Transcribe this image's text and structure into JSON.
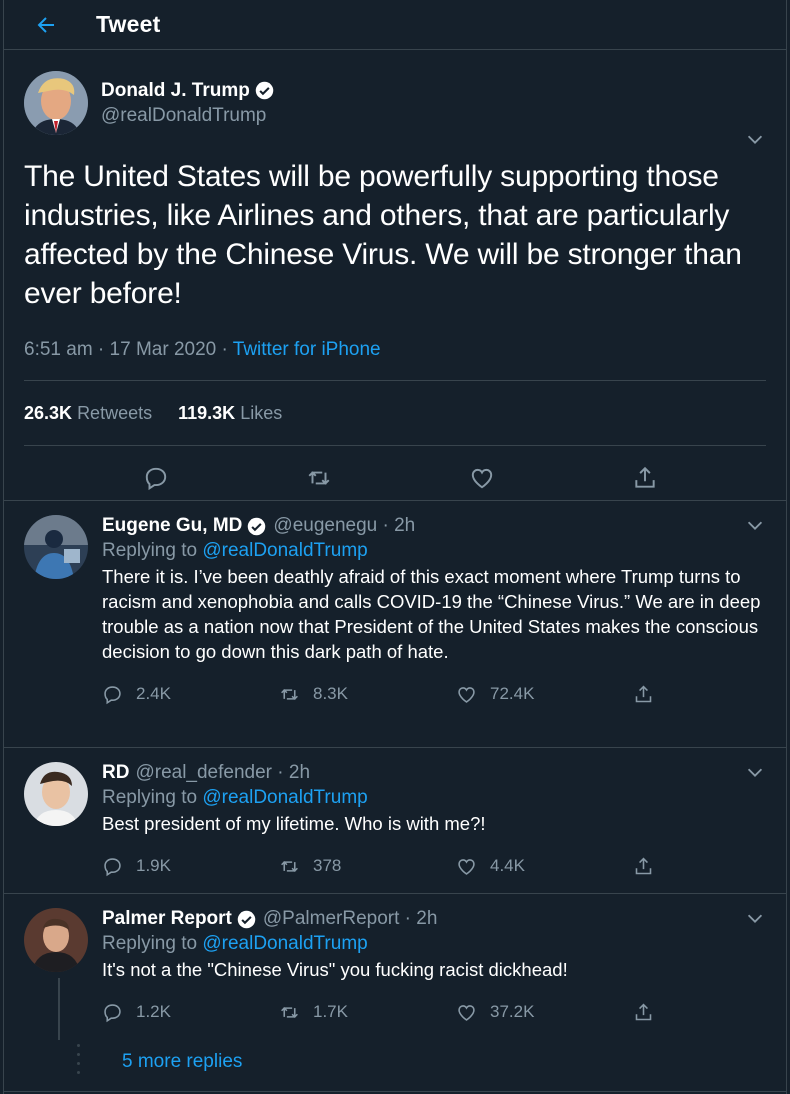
{
  "header": {
    "title": "Tweet"
  },
  "main_tweet": {
    "display_name": "Donald J. Trump",
    "handle": "@realDonaldTrump",
    "text": "The United States will be powerfully supporting those industries, like Airlines and others, that are particularly affected by the Chinese Virus. We will be stronger than ever before!",
    "time": "6:51 am · 17 Mar 2020 · ",
    "source": "Twitter for iPhone",
    "retweets_count": "26.3K",
    "retweets_label": "Retweets",
    "likes_count": "119.3K",
    "likes_label": "Likes"
  },
  "replies": [
    {
      "display_name": "Eugene Gu, MD",
      "handle": "@eugenegu · 2h",
      "replying_prefix": "Replying to ",
      "replying_to": "@realDonaldTrump",
      "text": "There it is. I’ve been deathly afraid of this exact moment where Trump turns to racism and xenophobia and calls COVID-19 the “Chinese Virus.” We are in deep trouble as a nation now that President of the United States makes the conscious decision to go down this dark path of hate.",
      "replies": "2.4K",
      "retweets": "8.3K",
      "likes": "72.4K"
    },
    {
      "display_name": "RD",
      "handle": "@real_defender · 2h",
      "replying_prefix": "Replying to ",
      "replying_to": "@realDonaldTrump",
      "text": "Best president of my lifetime. Who is with me?!",
      "replies": "1.9K",
      "retweets": "378",
      "likes": "4.4K"
    },
    {
      "display_name": "Palmer Report",
      "handle": "@PalmerReport · 2h",
      "replying_prefix": "Replying to ",
      "replying_to": "@realDonaldTrump",
      "text": "It's not a the \"Chinese Virus\" you fucking racist dickhead!",
      "replies": "1.2K",
      "retweets": "1.7K",
      "likes": "37.2K"
    }
  ],
  "more_replies": "5 more replies",
  "colors": {
    "background": "#15202b",
    "border": "#38444d",
    "accent": "#1da1f2",
    "secondary_text": "#8899a6"
  },
  "icons": [
    "back-arrow-icon",
    "verified-badge-icon",
    "chevron-down-icon",
    "reply-icon",
    "retweet-icon",
    "like-icon",
    "share-icon"
  ]
}
